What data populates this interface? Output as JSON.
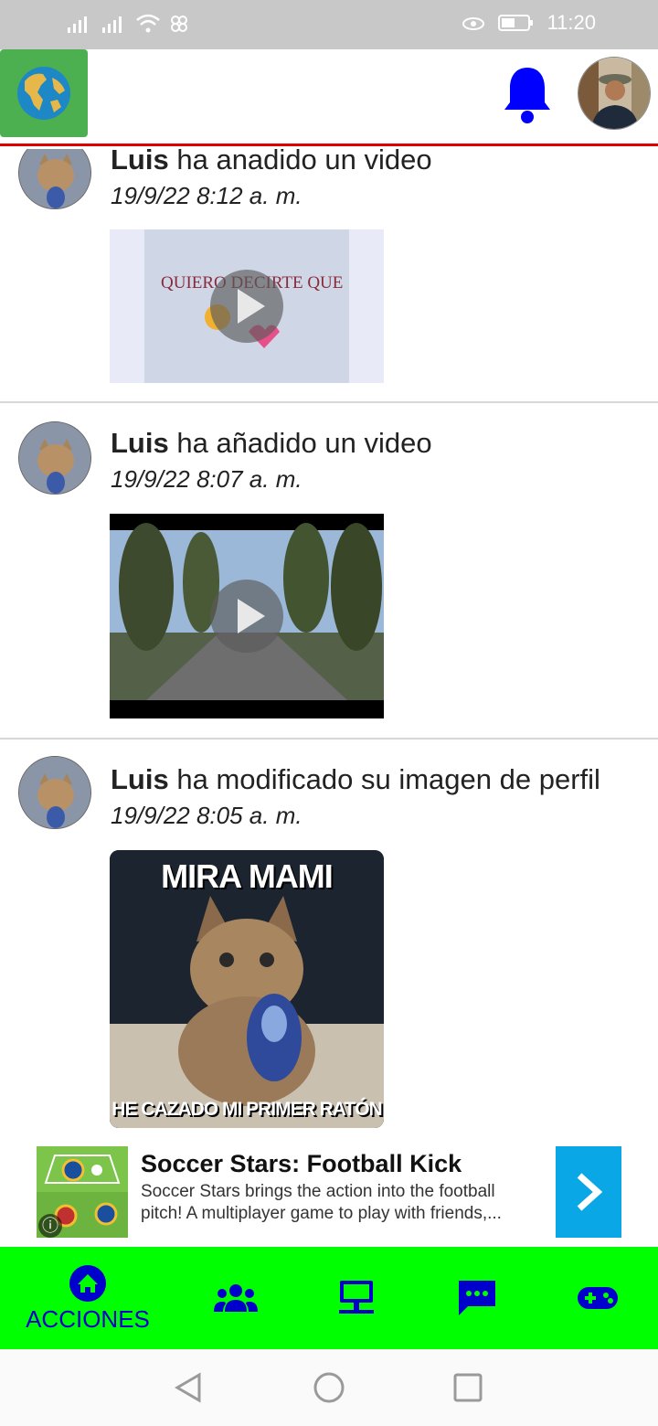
{
  "status_bar": {
    "time": "11:20"
  },
  "header": {
    "globe_icon": "globe-icon",
    "bell_icon": "bell-icon",
    "colors": {
      "globe_bg": "#4caf50",
      "bell": "#0000ff",
      "divider": "#e00000"
    }
  },
  "posts": [
    {
      "user": "Luis",
      "action": "ha anadido un video",
      "date": "19/9/22 8:12 a. m.",
      "media_caption": "QUIERO DECIRTE QUE"
    },
    {
      "user": "Luis",
      "action": "ha añadido un video",
      "date": "19/9/22 8:07 a. m."
    },
    {
      "user": "Luis",
      "action": "ha modificado su imagen de perfil",
      "date": "19/9/22 8:05 a. m.",
      "meme_top": "MIRA MAMI",
      "meme_bottom": "HE CAZADO MI PRIMER RATÓN"
    }
  ],
  "ad": {
    "title": "Soccer Stars: Football Kick",
    "description": "Soccer Stars brings the action into the football pitch! A multiplayer game to play with friends,...",
    "info_icon": "info-icon",
    "arrow_icon": "chevron-right-icon"
  },
  "bottom_nav": {
    "items": [
      {
        "label": "ACCIONES",
        "icon": "home-icon"
      },
      {
        "label": "",
        "icon": "group-icon"
      },
      {
        "label": "",
        "icon": "network-icon"
      },
      {
        "label": "",
        "icon": "chat-icon"
      },
      {
        "label": "",
        "icon": "gamepad-icon"
      }
    ],
    "colors": {
      "bg": "#00ff00",
      "icon": "#0000cc"
    }
  }
}
